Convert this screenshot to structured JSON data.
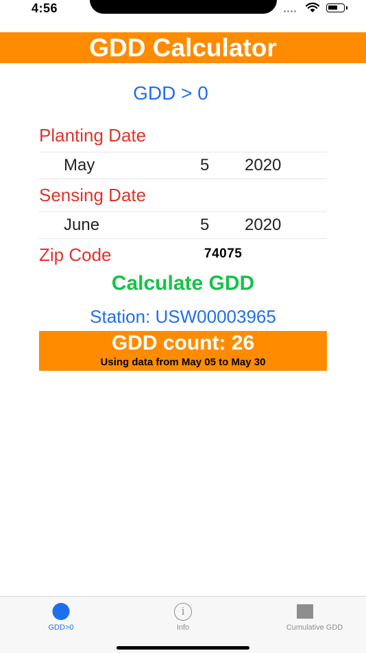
{
  "status_bar": {
    "time": "4:56"
  },
  "header": {
    "title": "GDD Calculator"
  },
  "mode_title": "GDD > 0",
  "planting": {
    "label": "Planting Date",
    "month": "May",
    "day": "5",
    "year": "2020"
  },
  "sensing": {
    "label": "Sensing Date",
    "month": "June",
    "day": "5",
    "year": "2020"
  },
  "zip": {
    "label": "Zip Code",
    "value": "74075"
  },
  "calculate_label": "Calculate GDD",
  "station": "Station: USW00003965",
  "result": {
    "count_text": "GDD count: 26",
    "range_text": "Using data from May 05 to May 30"
  },
  "tabs": [
    {
      "label": "GDD>0",
      "icon": "filled-circle-icon",
      "active": true
    },
    {
      "label": "Info",
      "icon": "info-icon",
      "active": false
    },
    {
      "label": "Cumulative GDD",
      "icon": "square-icon",
      "active": false
    }
  ],
  "colors": {
    "accent_orange": "#ff8c00",
    "title_blue": "#1e6ff0",
    "label_red": "#e0322a",
    "button_green": "#16c248",
    "inactive_gray": "#8e8e8e"
  }
}
